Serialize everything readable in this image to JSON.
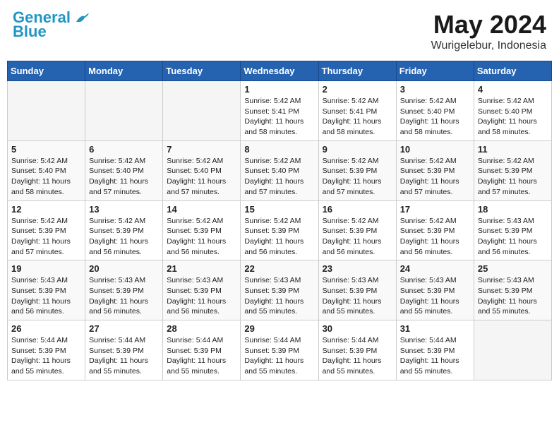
{
  "logo": {
    "text1": "General",
    "text2": "Blue"
  },
  "title": {
    "month": "May 2024",
    "location": "Wurigelebur, Indonesia"
  },
  "weekdays": [
    "Sunday",
    "Monday",
    "Tuesday",
    "Wednesday",
    "Thursday",
    "Friday",
    "Saturday"
  ],
  "weeks": [
    [
      {
        "day": "",
        "info": ""
      },
      {
        "day": "",
        "info": ""
      },
      {
        "day": "",
        "info": ""
      },
      {
        "day": "1",
        "info": "Sunrise: 5:42 AM\nSunset: 5:41 PM\nDaylight: 11 hours\nand 58 minutes."
      },
      {
        "day": "2",
        "info": "Sunrise: 5:42 AM\nSunset: 5:41 PM\nDaylight: 11 hours\nand 58 minutes."
      },
      {
        "day": "3",
        "info": "Sunrise: 5:42 AM\nSunset: 5:40 PM\nDaylight: 11 hours\nand 58 minutes."
      },
      {
        "day": "4",
        "info": "Sunrise: 5:42 AM\nSunset: 5:40 PM\nDaylight: 11 hours\nand 58 minutes."
      }
    ],
    [
      {
        "day": "5",
        "info": "Sunrise: 5:42 AM\nSunset: 5:40 PM\nDaylight: 11 hours\nand 58 minutes."
      },
      {
        "day": "6",
        "info": "Sunrise: 5:42 AM\nSunset: 5:40 PM\nDaylight: 11 hours\nand 57 minutes."
      },
      {
        "day": "7",
        "info": "Sunrise: 5:42 AM\nSunset: 5:40 PM\nDaylight: 11 hours\nand 57 minutes."
      },
      {
        "day": "8",
        "info": "Sunrise: 5:42 AM\nSunset: 5:40 PM\nDaylight: 11 hours\nand 57 minutes."
      },
      {
        "day": "9",
        "info": "Sunrise: 5:42 AM\nSunset: 5:39 PM\nDaylight: 11 hours\nand 57 minutes."
      },
      {
        "day": "10",
        "info": "Sunrise: 5:42 AM\nSunset: 5:39 PM\nDaylight: 11 hours\nand 57 minutes."
      },
      {
        "day": "11",
        "info": "Sunrise: 5:42 AM\nSunset: 5:39 PM\nDaylight: 11 hours\nand 57 minutes."
      }
    ],
    [
      {
        "day": "12",
        "info": "Sunrise: 5:42 AM\nSunset: 5:39 PM\nDaylight: 11 hours\nand 57 minutes."
      },
      {
        "day": "13",
        "info": "Sunrise: 5:42 AM\nSunset: 5:39 PM\nDaylight: 11 hours\nand 56 minutes."
      },
      {
        "day": "14",
        "info": "Sunrise: 5:42 AM\nSunset: 5:39 PM\nDaylight: 11 hours\nand 56 minutes."
      },
      {
        "day": "15",
        "info": "Sunrise: 5:42 AM\nSunset: 5:39 PM\nDaylight: 11 hours\nand 56 minutes."
      },
      {
        "day": "16",
        "info": "Sunrise: 5:42 AM\nSunset: 5:39 PM\nDaylight: 11 hours\nand 56 minutes."
      },
      {
        "day": "17",
        "info": "Sunrise: 5:42 AM\nSunset: 5:39 PM\nDaylight: 11 hours\nand 56 minutes."
      },
      {
        "day": "18",
        "info": "Sunrise: 5:43 AM\nSunset: 5:39 PM\nDaylight: 11 hours\nand 56 minutes."
      }
    ],
    [
      {
        "day": "19",
        "info": "Sunrise: 5:43 AM\nSunset: 5:39 PM\nDaylight: 11 hours\nand 56 minutes."
      },
      {
        "day": "20",
        "info": "Sunrise: 5:43 AM\nSunset: 5:39 PM\nDaylight: 11 hours\nand 56 minutes."
      },
      {
        "day": "21",
        "info": "Sunrise: 5:43 AM\nSunset: 5:39 PM\nDaylight: 11 hours\nand 56 minutes."
      },
      {
        "day": "22",
        "info": "Sunrise: 5:43 AM\nSunset: 5:39 PM\nDaylight: 11 hours\nand 55 minutes."
      },
      {
        "day": "23",
        "info": "Sunrise: 5:43 AM\nSunset: 5:39 PM\nDaylight: 11 hours\nand 55 minutes."
      },
      {
        "day": "24",
        "info": "Sunrise: 5:43 AM\nSunset: 5:39 PM\nDaylight: 11 hours\nand 55 minutes."
      },
      {
        "day": "25",
        "info": "Sunrise: 5:43 AM\nSunset: 5:39 PM\nDaylight: 11 hours\nand 55 minutes."
      }
    ],
    [
      {
        "day": "26",
        "info": "Sunrise: 5:44 AM\nSunset: 5:39 PM\nDaylight: 11 hours\nand 55 minutes."
      },
      {
        "day": "27",
        "info": "Sunrise: 5:44 AM\nSunset: 5:39 PM\nDaylight: 11 hours\nand 55 minutes."
      },
      {
        "day": "28",
        "info": "Sunrise: 5:44 AM\nSunset: 5:39 PM\nDaylight: 11 hours\nand 55 minutes."
      },
      {
        "day": "29",
        "info": "Sunrise: 5:44 AM\nSunset: 5:39 PM\nDaylight: 11 hours\nand 55 minutes."
      },
      {
        "day": "30",
        "info": "Sunrise: 5:44 AM\nSunset: 5:39 PM\nDaylight: 11 hours\nand 55 minutes."
      },
      {
        "day": "31",
        "info": "Sunrise: 5:44 AM\nSunset: 5:39 PM\nDaylight: 11 hours\nand 55 minutes."
      },
      {
        "day": "",
        "info": ""
      }
    ]
  ]
}
